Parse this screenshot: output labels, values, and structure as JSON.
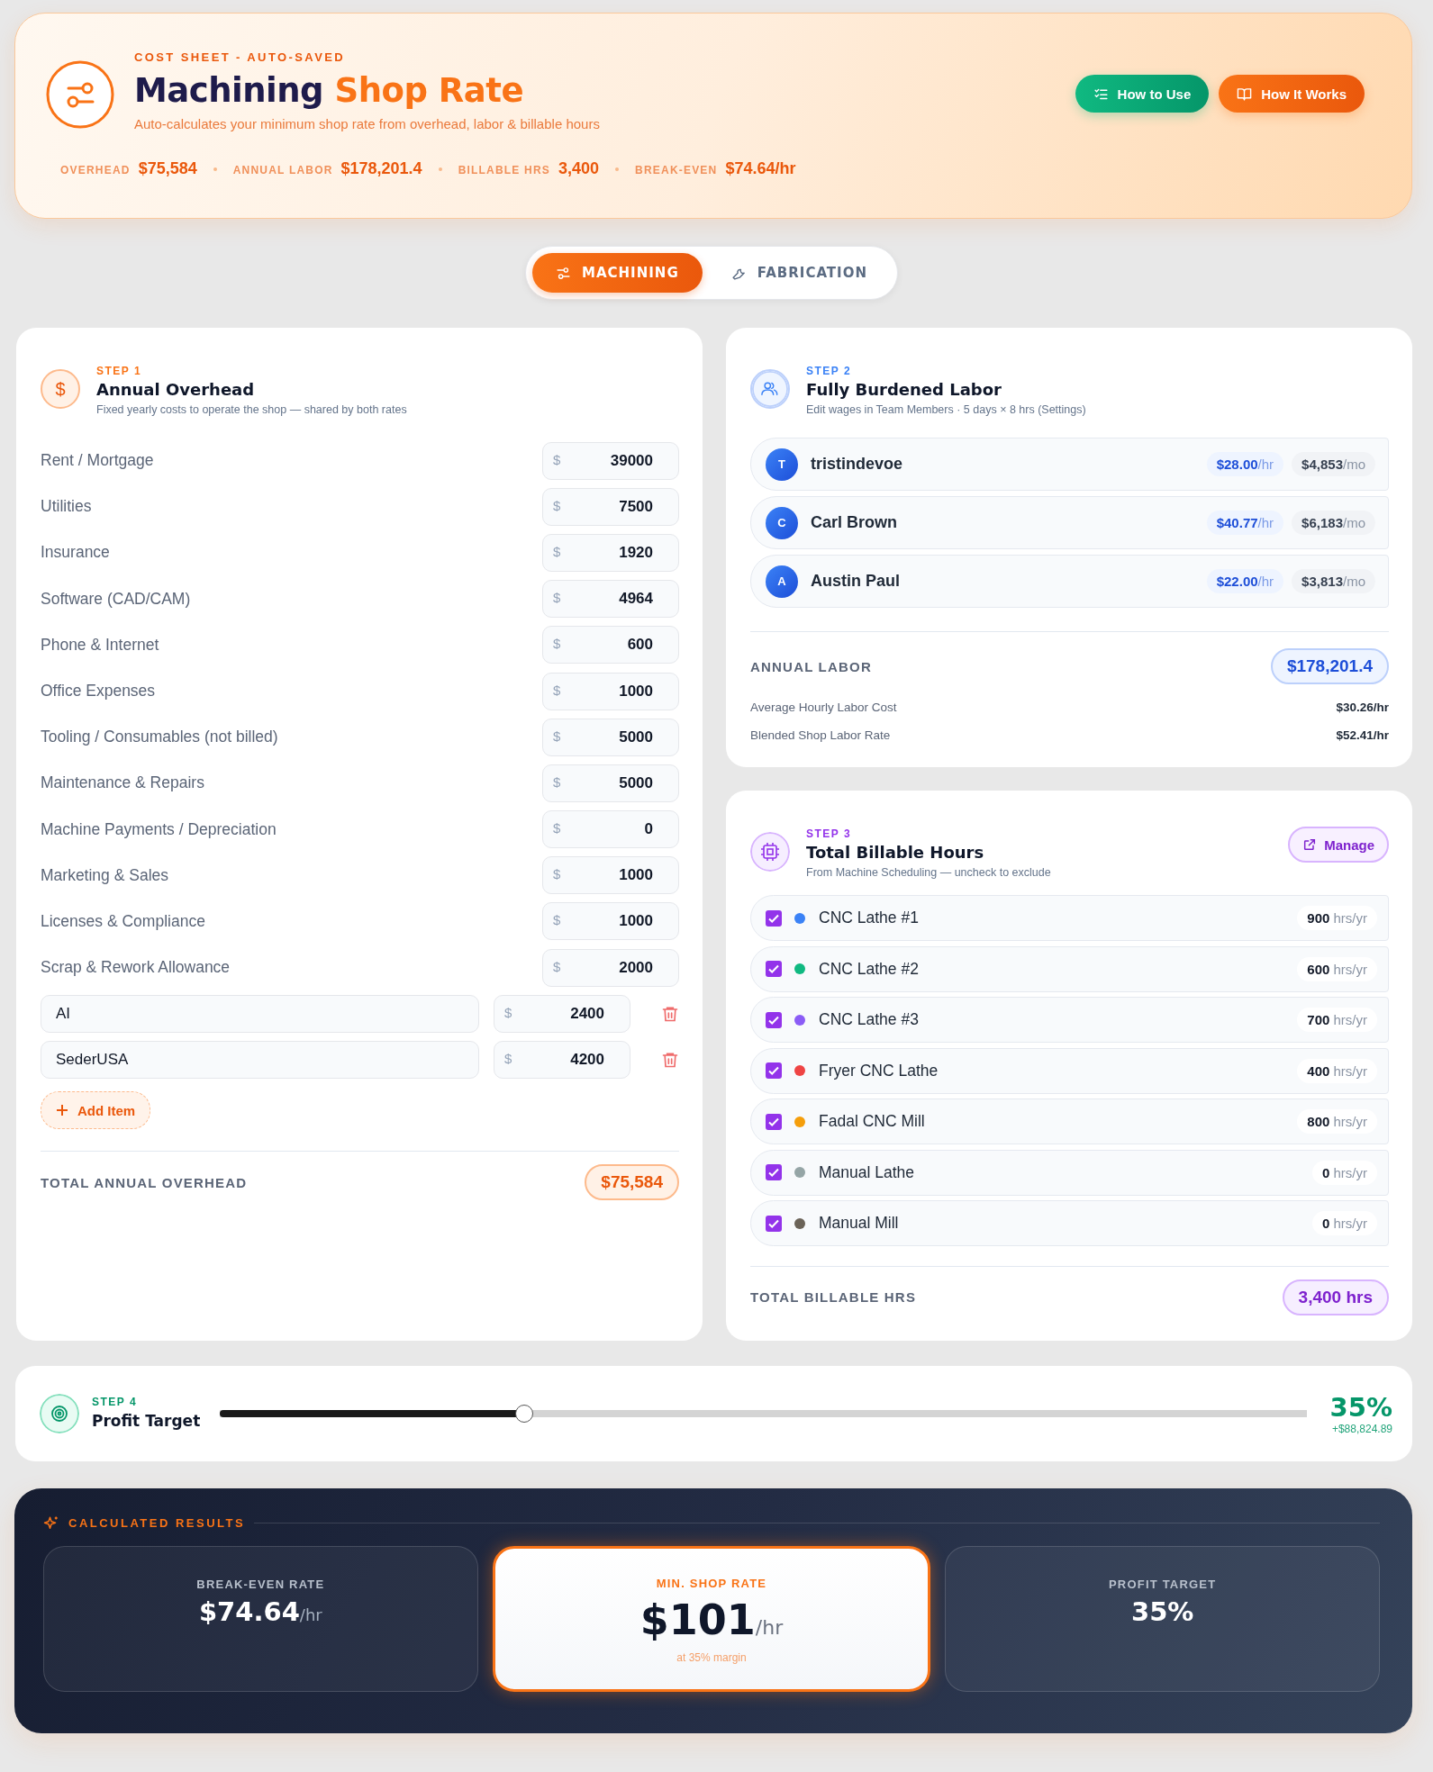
{
  "header": {
    "eyebrow": "COST SHEET - AUTO-SAVED",
    "title": "Machining",
    "title_accent": "Shop Rate",
    "subtitle": "Auto-calculates your minimum shop rate from overhead, labor & billable hours",
    "stats": [
      {
        "label": "OVERHEAD",
        "value": "$75,584"
      },
      {
        "label": "ANNUAL LABOR",
        "value": "$178,201.4"
      },
      {
        "label": "BILLABLE HRS",
        "value": "3,400"
      },
      {
        "label": "BREAK-EVEN",
        "value": "$74.64/hr"
      }
    ],
    "buttons": [
      {
        "label": "How to Use",
        "kind": "checklist"
      },
      {
        "label": "How It Works",
        "kind": "book"
      }
    ]
  },
  "tabs": [
    {
      "label": "MACHINING",
      "kind": "sliders",
      "selected": true
    },
    {
      "label": "FABRICATION",
      "kind": "wrench",
      "selected": false
    }
  ],
  "overhead": {
    "badge": "$",
    "step": "STEP 1",
    "title": "Annual Overhead",
    "subtitle": "Fixed yearly costs to operate the shop — shared by both rates",
    "items": [
      {
        "label": "Rent / Mortgage",
        "currency": "$",
        "value": "39000"
      },
      {
        "label": "Utilities",
        "currency": "$",
        "value": "7500"
      },
      {
        "label": "Insurance",
        "currency": "$",
        "value": "1920"
      },
      {
        "label": "Software (CAD/CAM)",
        "currency": "$",
        "value": "4964"
      },
      {
        "label": "Phone & Internet",
        "currency": "$",
        "value": "600"
      },
      {
        "label": "Office Expenses",
        "currency": "$",
        "value": "1000"
      },
      {
        "label": "Tooling / Consumables (not billed)",
        "currency": "$",
        "value": "5000"
      },
      {
        "label": "Maintenance & Repairs",
        "currency": "$",
        "value": "5000"
      },
      {
        "label": "Machine Payments / Depreciation",
        "currency": "$",
        "value": "0"
      },
      {
        "label": "Marketing & Sales",
        "currency": "$",
        "value": "1000"
      },
      {
        "label": "Licenses & Compliance",
        "currency": "$",
        "value": "1000"
      },
      {
        "label": "Scrap & Rework Allowance",
        "currency": "$",
        "value": "2000"
      }
    ],
    "custom_items": [
      {
        "name": "AI",
        "currency": "$",
        "value": "2400"
      },
      {
        "name": "SederUSA",
        "currency": "$",
        "value": "4200"
      }
    ],
    "add_button": "Add Item",
    "total_label": "TOTAL ANNUAL OVERHEAD",
    "total_value": "$75,584"
  },
  "labor": {
    "step": "STEP 2",
    "title": "Fully Burdened Labor",
    "subtitle": "Edit wages in Team Members · 5 days × 8 hrs (Settings)",
    "members": [
      {
        "initial": "T",
        "name": "tristindevoe",
        "rate": "$28.00",
        "rate_unit": "/hr",
        "monthly": "$4,853",
        "monthly_unit": "/mo"
      },
      {
        "initial": "C",
        "name": "Carl Brown",
        "rate": "$40.77",
        "rate_unit": "/hr",
        "monthly": "$6,183",
        "monthly_unit": "/mo"
      },
      {
        "initial": "A",
        "name": "Austin Paul",
        "rate": "$22.00",
        "rate_unit": "/hr",
        "monthly": "$3,813",
        "monthly_unit": "/mo"
      }
    ],
    "total_label": "ANNUAL LABOR",
    "total_value": "$178,201.4",
    "stats": [
      {
        "label": "Average Hourly Labor Cost",
        "value": "$30.26/hr"
      },
      {
        "label": "Blended Shop Labor Rate",
        "value": "$52.41/hr"
      }
    ]
  },
  "hours": {
    "step": "STEP 3",
    "title": "Total Billable Hours",
    "subtitle": "From Machine Scheduling — uncheck to exclude",
    "manage_button": "Manage",
    "machines": [
      {
        "checked": true,
        "color": "#3b82f6",
        "name": "CNC Lathe #1",
        "hours": "900",
        "unit": "hrs/yr"
      },
      {
        "checked": true,
        "color": "#10b981",
        "name": "CNC Lathe #2",
        "hours": "600",
        "unit": "hrs/yr"
      },
      {
        "checked": true,
        "color": "#8b5cf6",
        "name": "CNC Lathe #3",
        "hours": "700",
        "unit": "hrs/yr"
      },
      {
        "checked": true,
        "color": "#ef4444",
        "name": "Fryer CNC Lathe",
        "hours": "400",
        "unit": "hrs/yr"
      },
      {
        "checked": true,
        "color": "#f59e0b",
        "name": "Fadal CNC Mill",
        "hours": "800",
        "unit": "hrs/yr"
      },
      {
        "checked": true,
        "color": "#95a5a6",
        "name": "Manual Lathe",
        "hours": "0",
        "unit": "hrs/yr"
      },
      {
        "checked": true,
        "color": "#6b6358",
        "name": "Manual Mill",
        "hours": "0",
        "unit": "hrs/yr"
      }
    ],
    "total_label": "TOTAL BILLABLE HRS",
    "total_value": "3,400 hrs"
  },
  "profit": {
    "step": "STEP 4",
    "title": "Profit Target",
    "level": 0.28,
    "percent": "35%",
    "amount": "+$88,824.89"
  },
  "results": {
    "title": "CALCULATED RESULTS",
    "cards": [
      {
        "label": "BREAK-EVEN RATE",
        "value": "$74.64",
        "unit": "/hr",
        "highlighted": false
      },
      {
        "label": "MIN. SHOP RATE",
        "value": "$101",
        "unit": "/hr",
        "note": "at 35% margin",
        "highlighted": true
      },
      {
        "label": "PROFIT TARGET",
        "value": "35%",
        "highlighted": false
      }
    ]
  }
}
